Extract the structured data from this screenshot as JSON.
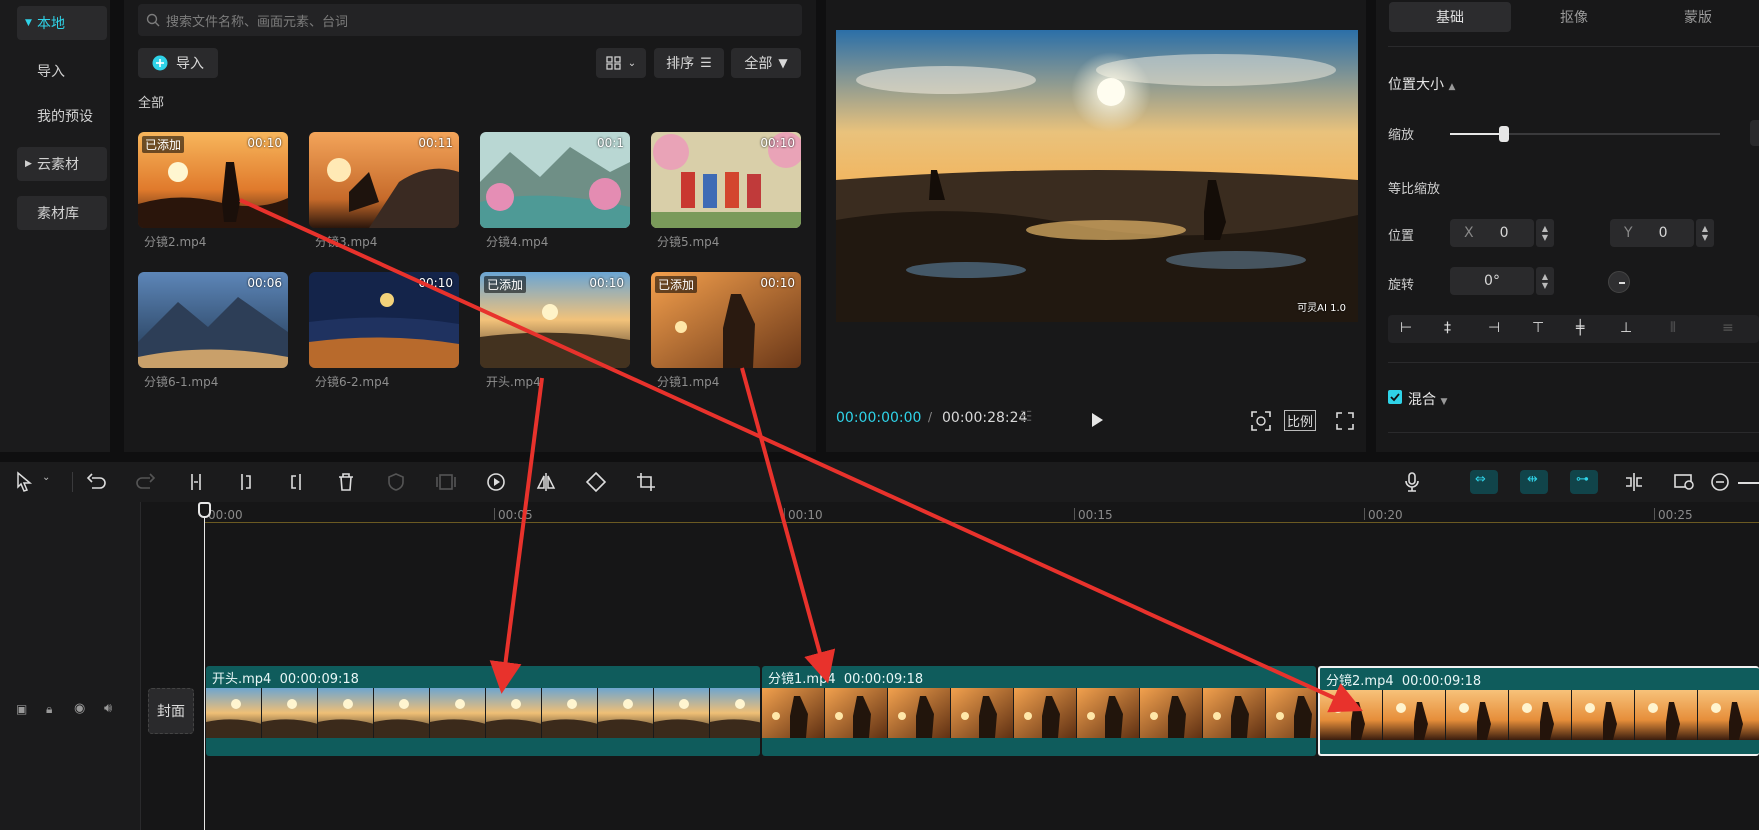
{
  "sidebar": {
    "items": [
      {
        "label": "本地",
        "caret": "▼"
      },
      {
        "label": "导入"
      },
      {
        "label": "我的预设"
      },
      {
        "label": "云素材",
        "caret": "▶"
      },
      {
        "label": "素材库"
      }
    ]
  },
  "media": {
    "search_placeholder": "搜索文件名称、画面元素、台词",
    "import_label": "导入",
    "sort_label": "排序",
    "filter_label": "全部",
    "section_label": "全部",
    "items": [
      {
        "name": "分镜2.mp4",
        "duration": "00:10",
        "added": "已添加"
      },
      {
        "name": "分镜3.mp4",
        "duration": "00:11",
        "added": ""
      },
      {
        "name": "分镜4.mp4",
        "duration": "00:1",
        "added": ""
      },
      {
        "name": "分镜5.mp4",
        "duration": "00:10",
        "added": ""
      },
      {
        "name": "分镜6-1.mp4",
        "duration": "00:06",
        "added": ""
      },
      {
        "name": "分镜6-2.mp4",
        "duration": "00:10",
        "added": ""
      },
      {
        "name": "开头.mp4",
        "duration": "00:10",
        "added": "已添加"
      },
      {
        "name": "分镜1.mp4",
        "duration": "00:10",
        "added": "已添加"
      }
    ]
  },
  "preview": {
    "current_time": "00:00:00:00",
    "total_time": "00:00:28:24",
    "ratio_label": "比例",
    "watermark": "可灵AI 1.0"
  },
  "props": {
    "tabs": [
      "基础",
      "抠像",
      "蒙版"
    ],
    "section_title": "位置大小",
    "scale_label": "缩放",
    "scale_fraction": 0.2,
    "uniform_label": "等比缩放",
    "position_label": "位置",
    "x_label": "X",
    "x_value": "0",
    "y_label": "Y",
    "y_value": "0",
    "rotate_label": "旋转",
    "rotate_value": "0°",
    "blend_label": "混合"
  },
  "timeline": {
    "ruler": [
      "00:00",
      "00:05",
      "00:10",
      "00:15",
      "00:20",
      "00:25"
    ],
    "cover_label": "封面",
    "clips": [
      {
        "name": "开头.mp4",
        "duration": "00:00:09:18"
      },
      {
        "name": "分镜1.mp4",
        "duration": "00:00:09:18"
      },
      {
        "name": "分镜2.mp4",
        "duration": "00:00:09:18"
      }
    ]
  },
  "colors": {
    "accent": "#2fd3e8",
    "clip": "#0f5c5c",
    "arrow": "#e8322c"
  }
}
